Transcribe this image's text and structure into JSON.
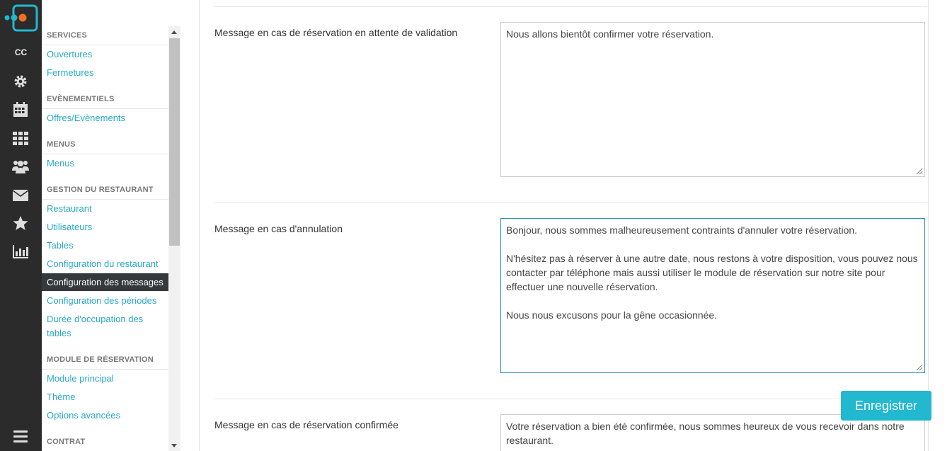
{
  "rail": {
    "user_initials": "CC",
    "icons": [
      "settings-icon",
      "calendar-icon",
      "grid-icon",
      "users-icon",
      "mail-icon",
      "star-icon",
      "stats-icon",
      "menu-icon"
    ],
    "brand_color": "#22b8cf"
  },
  "menu": {
    "sections": [
      {
        "title": "SERVICES",
        "items": [
          "Ouvertures",
          "Fermetures"
        ]
      },
      {
        "title": "EVÈNEMENTIELS",
        "items": [
          "Offres/Evènements"
        ]
      },
      {
        "title": "MENUS",
        "items": [
          "Menus"
        ]
      },
      {
        "title": "GESTION DU RESTAURANT",
        "items": [
          "Restaurant",
          "Utilisateurs",
          "Tables",
          "Configuration du restaurant",
          "Configuration des messages",
          "Configuration des périodes",
          "Durée d'occupation des",
          "tables"
        ]
      },
      {
        "title": "MODULE DE RÉSERVATION",
        "items": [
          "Module principal",
          "Thème",
          "Options avancées"
        ]
      },
      {
        "title": "CONTRAT",
        "items": []
      }
    ],
    "active_item": "Configuration des messages"
  },
  "form": {
    "fields": [
      {
        "label": "Message en cas de réservation en attente de validation",
        "value": "Nous allons bientôt confirmer votre réservation."
      },
      {
        "label": "Message en cas d'annulation",
        "value": "Bonjour, nous sommes malheureusement contraints d'annuler votre réservation.\n\nN'hésitez pas à réserver à une autre date, nous restons à votre disposition, vous pouvez nous contacter par téléphone mais aussi utiliser le module de réservation sur notre site pour effectuer une nouvelle réservation.\n\nNous nous excusons pour la gêne occasionnée."
      },
      {
        "label": "Message en cas de réservation confirmée",
        "value": "Votre réservation a bien été confirmée, nous sommes heureux de vous recevoir dans notre restaurant."
      }
    ],
    "save_label": "Enregistrer"
  }
}
